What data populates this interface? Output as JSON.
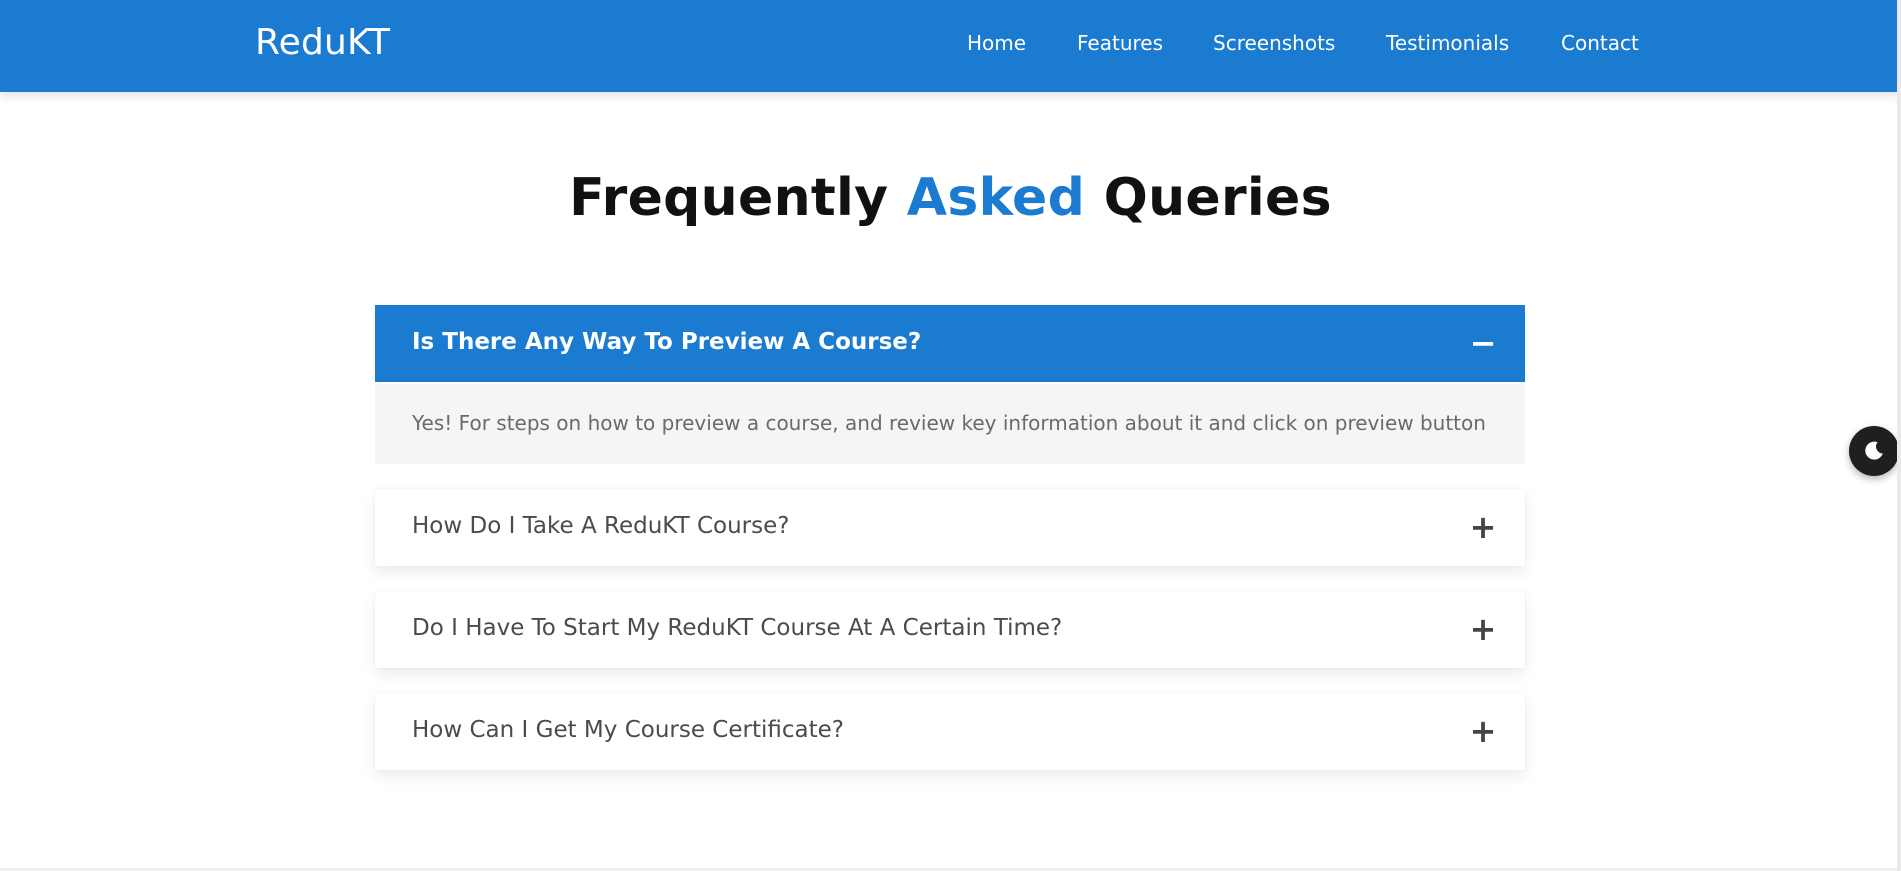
{
  "brand": "ReduKT",
  "nav": {
    "items": [
      {
        "label": "Home"
      },
      {
        "label": "Features"
      },
      {
        "label": "Screenshots"
      },
      {
        "label": "Testimonials"
      },
      {
        "label": "Contact"
      }
    ]
  },
  "faq": {
    "title_prefix": "Frequently",
    "title_accent": "Asked",
    "title_suffix": "Queries",
    "items": [
      {
        "question": "Is There Any Way To Preview A Course?",
        "toggle": "−",
        "expanded": true,
        "answer": "Yes! For steps on how to preview a course, and review key information about it and click on preview button"
      },
      {
        "question": "How Do I Take A ReduKT Course?",
        "toggle": "+",
        "expanded": false
      },
      {
        "question": "Do I Have To Start My ReduKT Course At A Certain Time?",
        "toggle": "+",
        "expanded": false
      },
      {
        "question": "How Can I Get My Course Certificate?",
        "toggle": "+",
        "expanded": false
      }
    ]
  },
  "theme_toggle": {
    "icon": "moon-icon"
  },
  "colors": {
    "primary": "#1a7bd0",
    "title_text": "#111111",
    "question_text": "#4b4b4b",
    "answer_bg": "#f5f5f5",
    "answer_text": "#6a6a6a",
    "toggle_bg": "#1f1f1f"
  }
}
